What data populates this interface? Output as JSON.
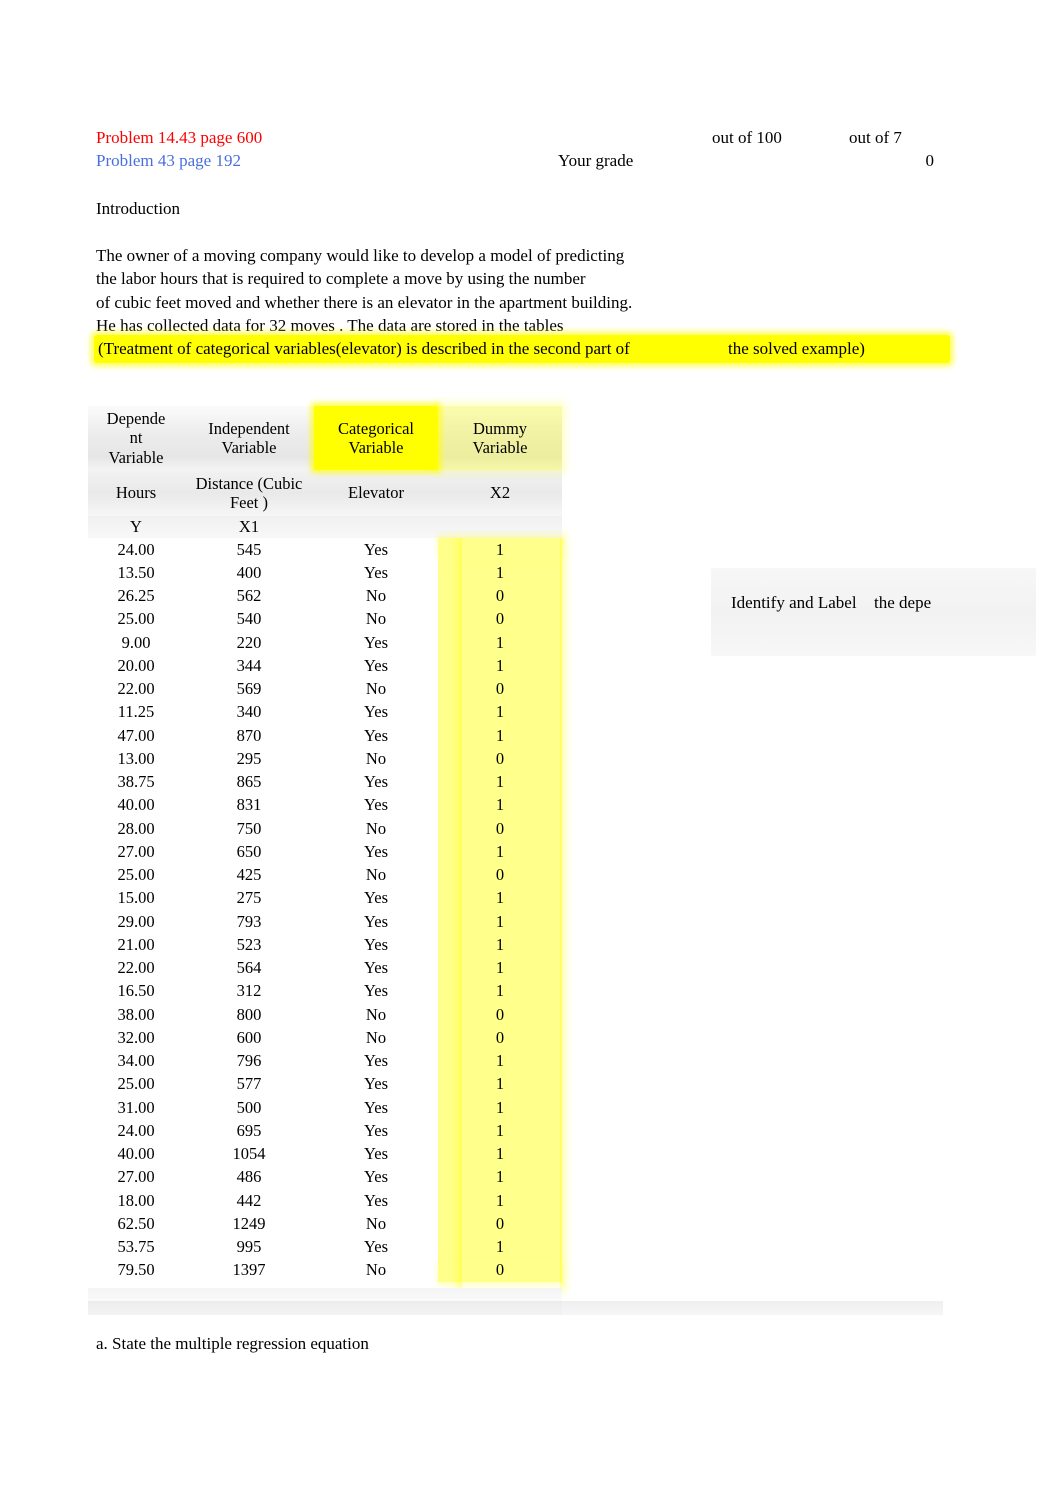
{
  "header": {
    "problem_primary": "Problem 14.43 page 600",
    "problem_secondary": "Problem 43 page 192",
    "out_of_100": "out of 100",
    "out_of_7": "out of 7",
    "your_grade_label": "Your grade",
    "your_grade_value": "0",
    "primary_color": "#ff0000",
    "secondary_color": "#4a6ee0"
  },
  "intro": {
    "title": "Introduction",
    "lines": [
      "The owner of a moving company would like to develop a model of predicting",
      "the labor hours that is required to complete a move by using the number",
      "of cubic feet moved and whether there is an elevator in the apartment building.",
      "He has collected data for 32 moves . The data are stored in the tables"
    ],
    "note_left": "(Treatment of categorical variables(elevator) is described in the second part of",
    "note_right": "the solved example)",
    "highlight_color": "#ffff00"
  },
  "callout": {
    "text_a": "Identify and Label",
    "text_b": "the depe"
  },
  "question": {
    "part_a": "a. State the multiple regression equation"
  },
  "chart_data": {
    "type": "table",
    "title": "Moving company labor hours data",
    "header_row_1": [
      "Dependent Variable",
      "Independent Variable",
      "Categorical Variable",
      "Dummy Variable"
    ],
    "header_row_1_wrapped": [
      "Depende\nnt\nVariable",
      "Independent\nVariable",
      "Categorical\nVariable",
      "Dummy\nVariable"
    ],
    "header_row_2": [
      "Hours",
      "Distance (Cubic Feet )",
      "Elevator",
      "X2"
    ],
    "header_row_3": [
      "Y",
      "X1",
      "",
      ""
    ],
    "columns": [
      "Y",
      "X1",
      "Elevator",
      "X2"
    ],
    "highlighted_columns": [
      "Elevator",
      "X2"
    ],
    "row_count": 32,
    "rows": [
      [
        "24.00",
        "545",
        "Yes",
        "1"
      ],
      [
        "13.50",
        "400",
        "Yes",
        "1"
      ],
      [
        "26.25",
        "562",
        "No",
        "0"
      ],
      [
        "25.00",
        "540",
        "No",
        "0"
      ],
      [
        "9.00",
        "220",
        "Yes",
        "1"
      ],
      [
        "20.00",
        "344",
        "Yes",
        "1"
      ],
      [
        "22.00",
        "569",
        "No",
        "0"
      ],
      [
        "11.25",
        "340",
        "Yes",
        "1"
      ],
      [
        "47.00",
        "870",
        "Yes",
        "1"
      ],
      [
        "13.00",
        "295",
        "No",
        "0"
      ],
      [
        "38.75",
        "865",
        "Yes",
        "1"
      ],
      [
        "40.00",
        "831",
        "Yes",
        "1"
      ],
      [
        "28.00",
        "750",
        "No",
        "0"
      ],
      [
        "27.00",
        "650",
        "Yes",
        "1"
      ],
      [
        "25.00",
        "425",
        "No",
        "0"
      ],
      [
        "15.00",
        "275",
        "Yes",
        "1"
      ],
      [
        "29.00",
        "793",
        "Yes",
        "1"
      ],
      [
        "21.00",
        "523",
        "Yes",
        "1"
      ],
      [
        "22.00",
        "564",
        "Yes",
        "1"
      ],
      [
        "16.50",
        "312",
        "Yes",
        "1"
      ],
      [
        "38.00",
        "800",
        "No",
        "0"
      ],
      [
        "32.00",
        "600",
        "No",
        "0"
      ],
      [
        "34.00",
        "796",
        "Yes",
        "1"
      ],
      [
        "25.00",
        "577",
        "Yes",
        "1"
      ],
      [
        "31.00",
        "500",
        "Yes",
        "1"
      ],
      [
        "24.00",
        "695",
        "Yes",
        "1"
      ],
      [
        "40.00",
        "1054",
        "Yes",
        "1"
      ],
      [
        "27.00",
        "486",
        "Yes",
        "1"
      ],
      [
        "18.00",
        "442",
        "Yes",
        "1"
      ],
      [
        "62.50",
        "1249",
        "No",
        "0"
      ],
      [
        "53.75",
        "995",
        "Yes",
        "1"
      ],
      [
        "79.50",
        "1397",
        "No",
        "0"
      ]
    ],
    "y_values": [
      24.0,
      13.5,
      26.25,
      25.0,
      9.0,
      20.0,
      22.0,
      11.25,
      47.0,
      13.0,
      38.75,
      40.0,
      28.0,
      27.0,
      25.0,
      15.0,
      29.0,
      21.0,
      22.0,
      16.5,
      38.0,
      32.0,
      34.0,
      25.0,
      31.0,
      24.0,
      40.0,
      27.0,
      18.0,
      62.5,
      53.75,
      79.5
    ],
    "x1_values": [
      545,
      400,
      562,
      540,
      220,
      344,
      569,
      340,
      870,
      295,
      865,
      831,
      750,
      650,
      425,
      275,
      793,
      523,
      564,
      312,
      800,
      600,
      796,
      577,
      500,
      695,
      1054,
      486,
      442,
      1249,
      995,
      1397
    ],
    "x2_values": [
      1,
      1,
      0,
      0,
      1,
      1,
      0,
      1,
      1,
      0,
      1,
      1,
      0,
      1,
      0,
      1,
      1,
      1,
      1,
      1,
      0,
      0,
      1,
      1,
      1,
      1,
      1,
      1,
      1,
      0,
      1,
      0
    ],
    "elevator_values": [
      "Yes",
      "Yes",
      "No",
      "No",
      "Yes",
      "Yes",
      "No",
      "Yes",
      "Yes",
      "No",
      "Yes",
      "Yes",
      "No",
      "Yes",
      "No",
      "Yes",
      "Yes",
      "Yes",
      "Yes",
      "Yes",
      "No",
      "No",
      "Yes",
      "Yes",
      "Yes",
      "Yes",
      "Yes",
      "Yes",
      "Yes",
      "No",
      "Yes",
      "No"
    ]
  }
}
